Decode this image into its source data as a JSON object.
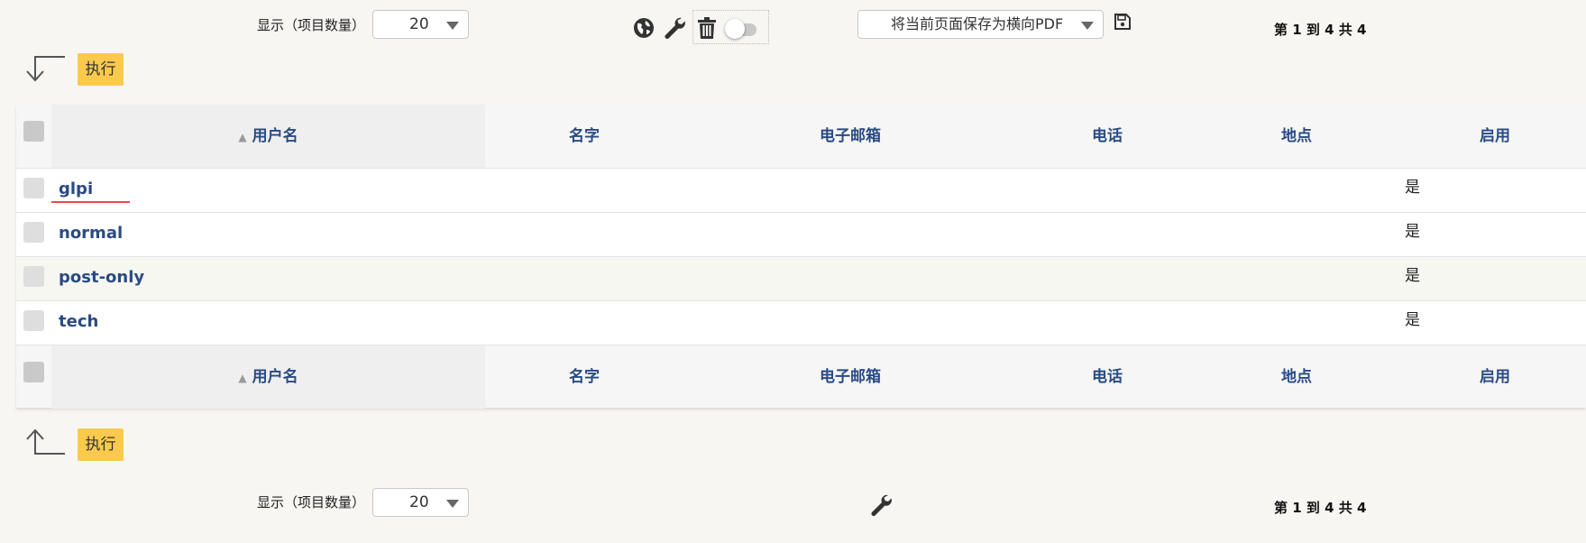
{
  "top_bar": {
    "display_label": "显示（项目数量）",
    "display_value": "20",
    "export_select": "将当前页面保存为横向PDF",
    "pager_text": "第 1 到 4 共 4"
  },
  "massive_actions": {
    "top_label": "执行",
    "bottom_label": "执行"
  },
  "table": {
    "columns": [
      "用户名",
      "名字",
      "电子邮箱",
      "电话",
      "地点",
      "启用"
    ],
    "rows": [
      {
        "login": "glpi",
        "enabled": "是"
      },
      {
        "login": "normal",
        "enabled": "是"
      },
      {
        "login": "post-only",
        "enabled": "是"
      },
      {
        "login": "tech",
        "enabled": "是"
      }
    ]
  },
  "bottom_bar": {
    "display_label": "显示（项目数量）",
    "display_value": "20",
    "pager_text": "第 1 到 4 共 4"
  },
  "icons": {
    "globe": "globe-icon",
    "wrench": "wrench-icon",
    "trash": "trash-icon",
    "save": "floppy-save-icon",
    "corner_down": "arrow-down-left-icon",
    "corner_up": "arrow-up-left-icon"
  },
  "colors": {
    "accent_button": "#fbc94c",
    "link": "#294b84",
    "highlight_underline": "#e8484d"
  }
}
